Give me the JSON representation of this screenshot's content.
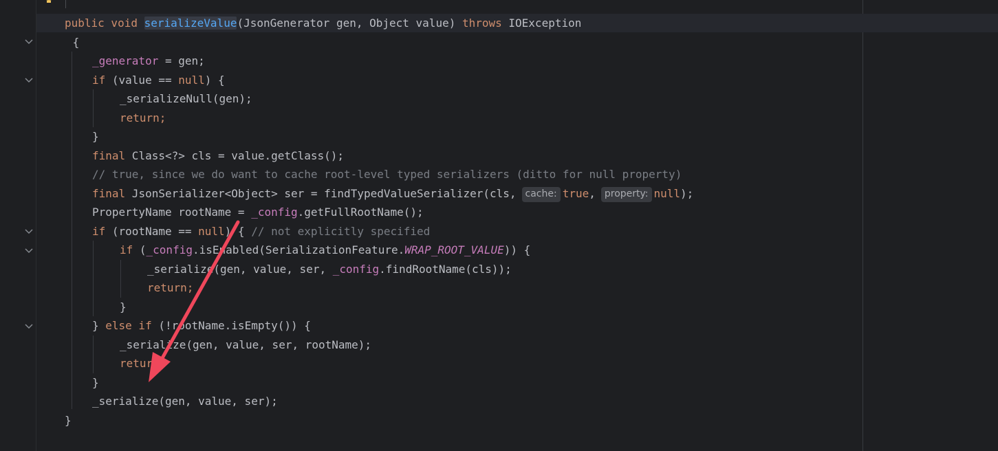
{
  "editor": {
    "signature": {
      "kw1": "public void ",
      "method": "serializeValue",
      "params": "(JsonGenerator gen, Object value) ",
      "kw2": "throws",
      "exc": " IOException"
    },
    "open_brace": " {",
    "l3": {
      "field": "_generator",
      "rest": " = gen;"
    },
    "l4": {
      "kw": "if",
      "a": " (value == ",
      "kw2": "null",
      "b": ") {"
    },
    "l5": "_serializeNull(gen);",
    "l6": "return;",
    "l7": "}",
    "l8": {
      "kw": "final",
      "rest": " Class<?> cls = value.getClass();"
    },
    "l9": "// true, since we do want to cache root-level typed serializers (ditto for null property)",
    "l10": {
      "kw": "final",
      "a": " JsonSerializer<Object> ser = findTypedValueSerializer(cls,",
      "hint1": "cache:",
      "v1": "true",
      "comma": ",",
      "hint2": "property:",
      "v2": "null",
      "end": ");"
    },
    "l11": {
      "a": "PropertyName rootName = ",
      "field": "_config",
      "b": ".getFullRootName();"
    },
    "l12": {
      "kw": "if",
      "a": " (rootName == ",
      "kw2": "null",
      "b": ") { ",
      "cmt": "// not explicitly specified"
    },
    "l13": {
      "kw": "if",
      "a": " (",
      "field": "_config",
      "b": ".isEnabled(SerializationFeature.",
      "const": "WRAP_ROOT_VALUE",
      "c": ")) {"
    },
    "l14": {
      "a": "_serialize(gen, value, ser, ",
      "field": "_config",
      "b": ".findRootName(cls));"
    },
    "l15": "return;",
    "l16": "}",
    "l17": {
      "a": "} ",
      "kw": "else if",
      "b": " (!rootName.isEmpty()) {"
    },
    "l18": "_serialize(gen, value, ser, rootName);",
    "l19": "return;",
    "l20": "}",
    "l21": "_serialize(gen, value, ser);",
    "l22": "}"
  },
  "icons": {
    "bulb": "lightbulb-icon",
    "fold": "chevron-down-icon"
  },
  "colors": {
    "background": "#1e1f22",
    "keyword": "#cf8e6d",
    "method": "#56a8f5",
    "field": "#c77dbb",
    "comment": "#7a7e85",
    "text": "#bcbec4",
    "arrow": "#f0475b"
  }
}
